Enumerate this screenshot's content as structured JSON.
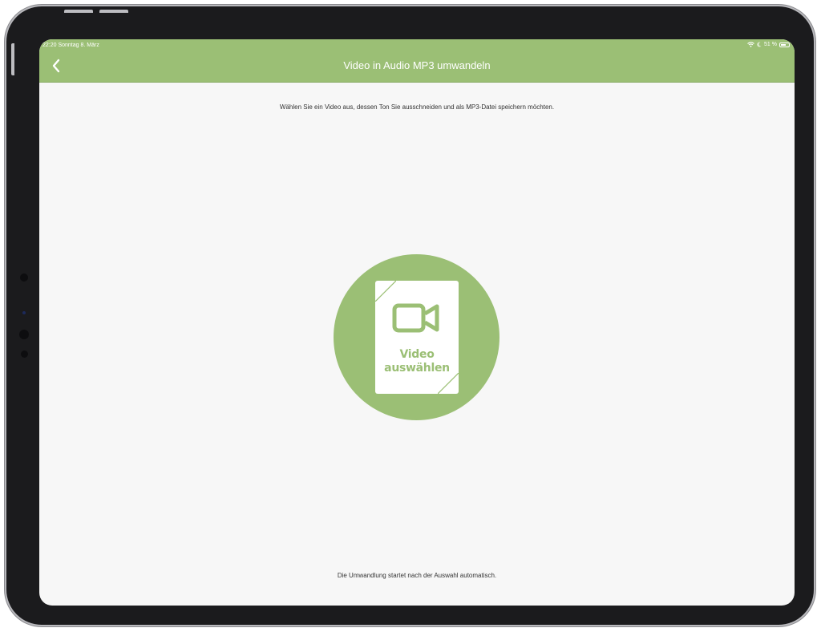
{
  "status_bar": {
    "time_date": "22:20  Sonntag 8. März",
    "battery": "51 %"
  },
  "navbar": {
    "title": "Video in Audio MP3 umwandeln",
    "back_icon": "chevron-left-icon"
  },
  "main": {
    "instruction": "Wählen Sie ein Video aus, dessen Ton Sie ausschneiden und als MP3-Datei speichern möchten.",
    "select_button": {
      "icon": "video-camera-icon",
      "label_line1": "Video",
      "label_line2": "auswählen"
    },
    "footer_note": "Die Umwandlung startet nach der Auswahl automatisch."
  },
  "colors": {
    "accent": "#9bbf75",
    "background": "#f7f7f7",
    "text": "#333333"
  }
}
